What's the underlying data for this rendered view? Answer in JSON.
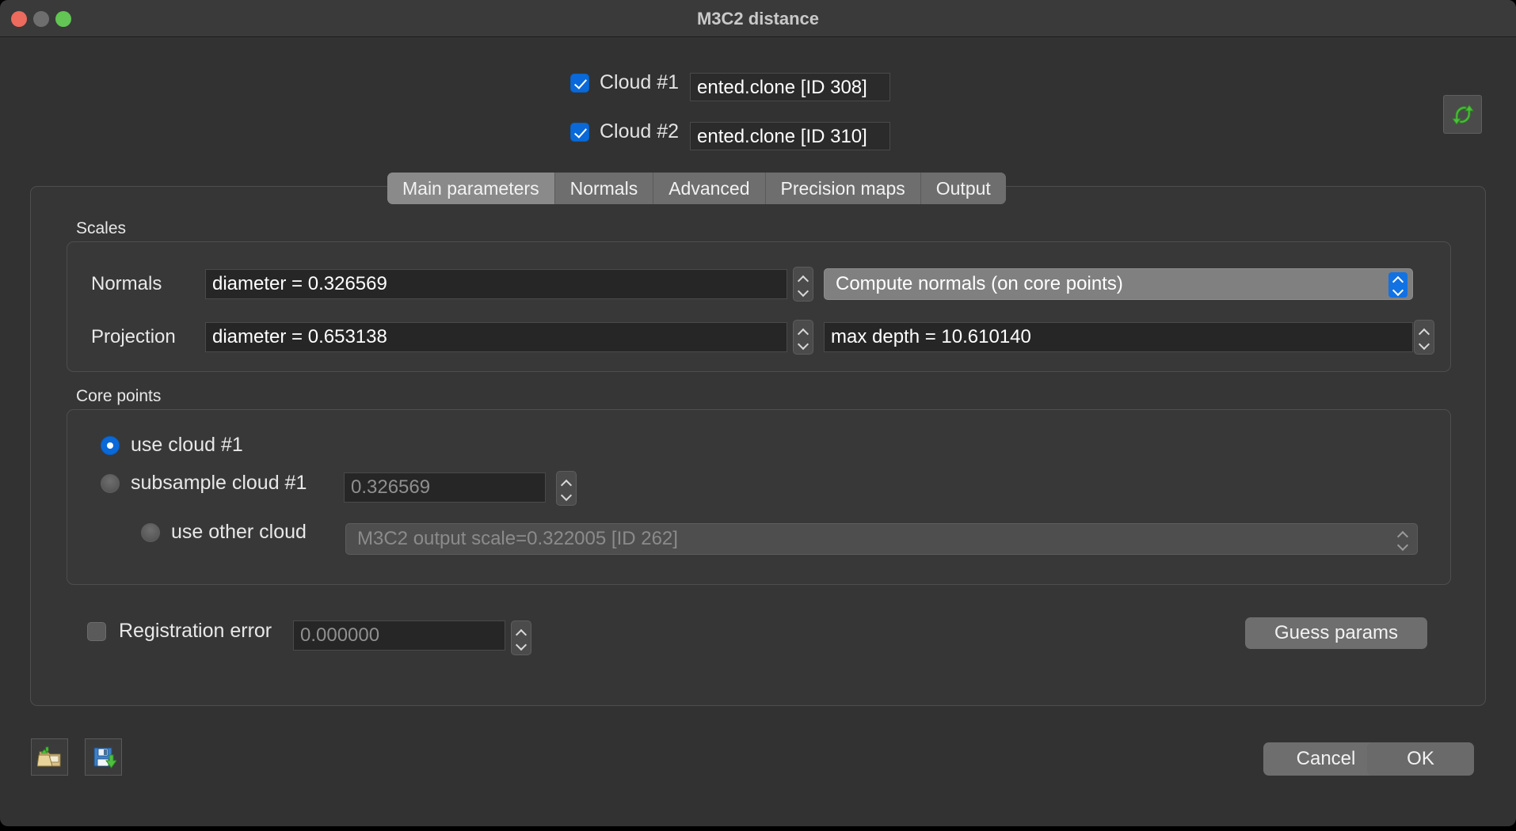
{
  "window": {
    "title": "M3C2 distance",
    "traffic_lights": [
      "close-button",
      "minimize-button",
      "zoom-button"
    ]
  },
  "clouds": [
    {
      "checkbox_label": "Cloud #1",
      "checked": true,
      "combo_value": "ented.clone [ID 308]"
    },
    {
      "checkbox_label": "Cloud #2",
      "checked": true,
      "combo_value": "ented.clone [ID 310]"
    }
  ],
  "swap_button": {
    "icon": "swap-arrows-icon",
    "tooltip": ""
  },
  "tabs": [
    {
      "label": "Main parameters",
      "active": true
    },
    {
      "label": "Normals",
      "active": false
    },
    {
      "label": "Advanced",
      "active": false
    },
    {
      "label": "Precision maps",
      "active": false
    },
    {
      "label": "Output",
      "active": false
    }
  ],
  "scales": {
    "group_title": "Scales",
    "normals": {
      "label": "Normals",
      "value": "diameter = 0.326569",
      "mode": "Compute normals (on core points)"
    },
    "projection": {
      "label": "Projection",
      "value": "diameter = 0.653138",
      "max_depth": "max depth = 10.610140"
    }
  },
  "core_points": {
    "group_title": "Core points",
    "use_cloud1": {
      "label": "use cloud #1",
      "selected": true
    },
    "subsample": {
      "label": "subsample cloud #1",
      "selected": false,
      "value": "0.326569"
    },
    "other_cloud": {
      "label": "use other cloud",
      "selected": false,
      "value": "M3C2 output scale=0.322005 [ID 262]"
    }
  },
  "registration": {
    "label": "Registration error",
    "checked": false,
    "value": "0.000000"
  },
  "buttons": {
    "guess_params": "Guess params",
    "cancel": "Cancel",
    "ok": "OK",
    "load_params_icon": "folder-open-icon",
    "save_params_icon": "floppy-disk-save-icon"
  },
  "colors": {
    "accent_blue": "#0a69d9",
    "combo_arrow_blue": "#1271e3",
    "window_bg": "#323232",
    "panel_bg": "#363636",
    "field_bg": "#262626",
    "button_bg": "#6e6e6e",
    "swap_green": "#55bb44"
  }
}
